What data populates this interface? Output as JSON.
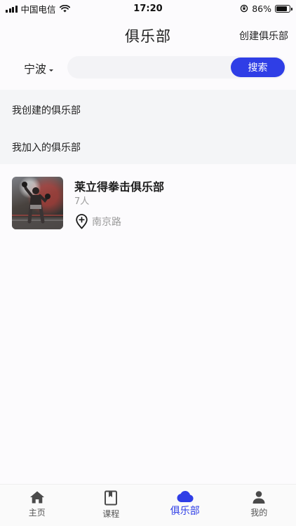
{
  "status_bar": {
    "carrier": "中国电信",
    "time": "17:20",
    "battery": "86%",
    "battery_level": 0.86
  },
  "header": {
    "title": "俱乐部",
    "create_label": "创建俱乐部"
  },
  "search": {
    "city": "宁波",
    "placeholder": "",
    "button_label": "搜索"
  },
  "filters": [
    {
      "label": "我创建的俱乐部"
    },
    {
      "label": "我加入的俱乐部"
    }
  ],
  "clubs": [
    {
      "name": "莱立得拳击俱乐部",
      "members": "7人",
      "location": "南京路"
    }
  ],
  "tabbar": {
    "accent_color": "#2f3ee6",
    "items": [
      {
        "label": "主页",
        "icon": "home-icon"
      },
      {
        "label": "课程",
        "icon": "book-icon"
      },
      {
        "label": "俱乐部",
        "icon": "cloud-icon",
        "active": true
      },
      {
        "label": "我的",
        "icon": "person-icon"
      }
    ]
  }
}
